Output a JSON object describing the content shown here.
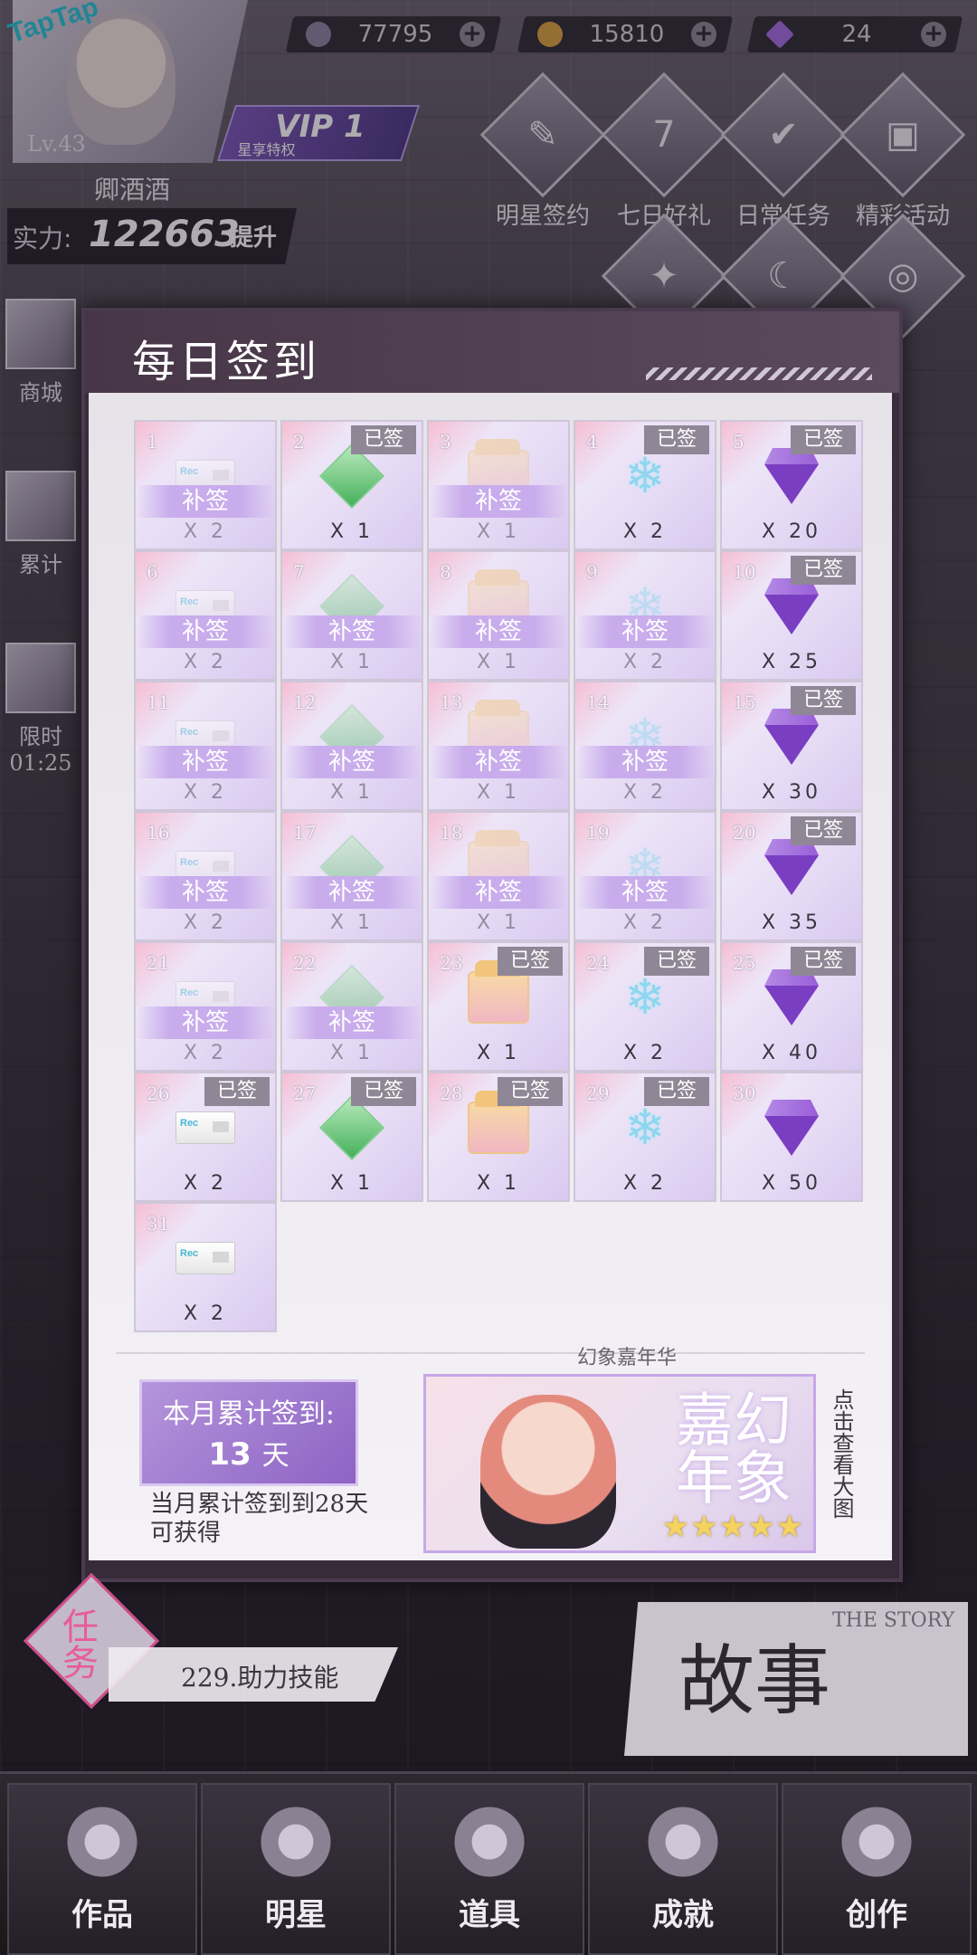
{
  "topbar": {
    "avatar": {
      "level": "Lv.43",
      "name": "卿酒酒",
      "brand": "TapTap"
    },
    "vip": {
      "label": "VIP 1",
      "sub": "星享特权"
    },
    "power": {
      "label": "实力:",
      "value": "122663",
      "upgrade": "提升"
    },
    "resources": [
      {
        "icon": "silver-coin-icon",
        "value": "77795",
        "color": "#8a84a0"
      },
      {
        "icon": "gold-coin-icon",
        "value": "15810",
        "color": "#d9a441"
      },
      {
        "icon": "diamond-icon",
        "value": "24",
        "color": "#a56ee0"
      }
    ]
  },
  "activities_row1": [
    {
      "label": "明星签约",
      "icon": "contract-icon",
      "glyph": "✎"
    },
    {
      "label": "七日好礼",
      "icon": "seven-day-gift-icon",
      "glyph": "7"
    },
    {
      "label": "日常任务",
      "icon": "checklist-icon",
      "glyph": "✔"
    },
    {
      "label": "精彩活动",
      "icon": "tv-icon",
      "glyph": "▣"
    }
  ],
  "activities_row2_glyphs": [
    "✦",
    "☾",
    "◎"
  ],
  "side_buttons": [
    {
      "label": "商城",
      "icon": "shop-icon"
    },
    {
      "label": "累计",
      "icon": "cumulative-icon"
    },
    {
      "label": "限时",
      "icon": "limited-bag-icon",
      "timer": "01:25"
    }
  ],
  "modal": {
    "title": "每日签到",
    "signed_label": "已签",
    "makeup_label": "补签",
    "days": [
      {
        "day": "1",
        "item": "card",
        "qty": "X 2",
        "state": "makeup"
      },
      {
        "day": "2",
        "item": "cube",
        "qty": "X 1",
        "state": "signed"
      },
      {
        "day": "3",
        "item": "gift",
        "qty": "X 1",
        "state": "makeup"
      },
      {
        "day": "4",
        "item": "snow",
        "qty": "X 2",
        "state": "signed"
      },
      {
        "day": "5",
        "item": "gem",
        "qty": "X 20",
        "state": "signed"
      },
      {
        "day": "6",
        "item": "card",
        "qty": "X 2",
        "state": "makeup"
      },
      {
        "day": "7",
        "item": "cube",
        "qty": "X 1",
        "state": "makeup"
      },
      {
        "day": "8",
        "item": "gift",
        "qty": "X 1",
        "state": "makeup"
      },
      {
        "day": "9",
        "item": "snow",
        "qty": "X 2",
        "state": "makeup"
      },
      {
        "day": "10",
        "item": "gem",
        "qty": "X 25",
        "state": "signed"
      },
      {
        "day": "11",
        "item": "card",
        "qty": "X 2",
        "state": "makeup"
      },
      {
        "day": "12",
        "item": "cube",
        "qty": "X 1",
        "state": "makeup"
      },
      {
        "day": "13",
        "item": "gift",
        "qty": "X 1",
        "state": "makeup"
      },
      {
        "day": "14",
        "item": "snow",
        "qty": "X 2",
        "state": "makeup"
      },
      {
        "day": "15",
        "item": "gem",
        "qty": "X 30",
        "state": "signed"
      },
      {
        "day": "16",
        "item": "card",
        "qty": "X 2",
        "state": "makeup"
      },
      {
        "day": "17",
        "item": "cube",
        "qty": "X 1",
        "state": "makeup"
      },
      {
        "day": "18",
        "item": "gift",
        "qty": "X 1",
        "state": "makeup"
      },
      {
        "day": "19",
        "item": "snow",
        "qty": "X 2",
        "state": "makeup"
      },
      {
        "day": "20",
        "item": "gem",
        "qty": "X 35",
        "state": "signed"
      },
      {
        "day": "21",
        "item": "card",
        "qty": "X 2",
        "state": "makeup"
      },
      {
        "day": "22",
        "item": "cube",
        "qty": "X 1",
        "state": "makeup"
      },
      {
        "day": "23",
        "item": "gift",
        "qty": "X 1",
        "state": "signed"
      },
      {
        "day": "24",
        "item": "snow",
        "qty": "X 2",
        "state": "signed"
      },
      {
        "day": "25",
        "item": "gem",
        "qty": "X 40",
        "state": "signed"
      },
      {
        "day": "26",
        "item": "card",
        "qty": "X 2",
        "state": "signed"
      },
      {
        "day": "27",
        "item": "cube",
        "qty": "X 1",
        "state": "signed"
      },
      {
        "day": "28",
        "item": "gift",
        "qty": "X 1",
        "state": "signed"
      },
      {
        "day": "29",
        "item": "snow",
        "qty": "X 2",
        "state": "signed"
      },
      {
        "day": "30",
        "item": "gem",
        "qty": "X 50",
        "state": "none"
      },
      {
        "day": "31",
        "item": "card",
        "qty": "X 2",
        "state": "none"
      }
    ],
    "summary": {
      "title": "本月累计签到:",
      "count": "13",
      "unit": "天",
      "note": "当月累计签到到28天可获得"
    },
    "reward": {
      "caption": "幻象嘉年华",
      "art_text": "幻象嘉年",
      "stars": "★★★★★",
      "view_link": "点击查看大图"
    }
  },
  "task": {
    "tag": "任务",
    "text": "229.助力技能"
  },
  "story": {
    "title": "故事",
    "sub": "THE STORY"
  },
  "nav": [
    {
      "label": "作品",
      "icon": "film-icon"
    },
    {
      "label": "明星",
      "icon": "star-badge-icon"
    },
    {
      "label": "道具",
      "icon": "wardrobe-icon"
    },
    {
      "label": "成就",
      "icon": "trophy-icon"
    },
    {
      "label": "创作",
      "icon": "camera-icon"
    }
  ]
}
